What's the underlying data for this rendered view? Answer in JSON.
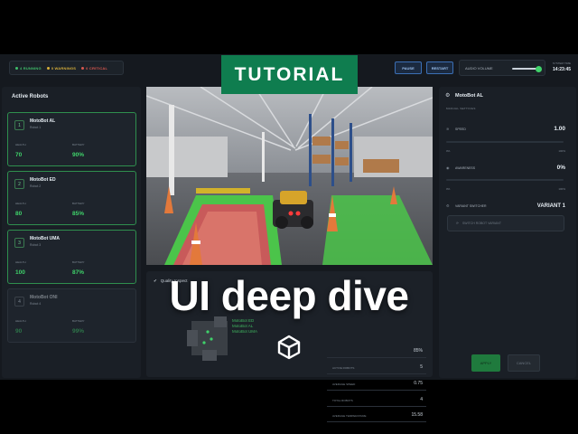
{
  "overlay": {
    "tutorial": "TUTORIAL",
    "headline": "UI deep dive"
  },
  "statusbar": {
    "running": "4 RUNNING",
    "warnings": "0 WARNINGS",
    "critical": "0 CRITICAL"
  },
  "toolbar": {
    "pause": "PAUSE",
    "restart": "RESTART",
    "audio_label": "AUDIO VOLUME",
    "system_time_label": "SYSTEM TIME",
    "system_time": "14:23:45"
  },
  "left_panel": {
    "title": "Active Robots",
    "health_label": "HEALTH",
    "battery_label": "BATTERY",
    "robots": [
      {
        "num": "1",
        "name": "MotoBot AL",
        "sub": "Robot 1",
        "health": "70",
        "battery": "90%"
      },
      {
        "num": "2",
        "name": "MotoBot ED",
        "sub": "Robot 2",
        "health": "80",
        "battery": "85%"
      },
      {
        "num": "3",
        "name": "MotoBot UMA",
        "sub": "Robot 3",
        "health": "100",
        "battery": "87%"
      },
      {
        "num": "4",
        "name": "MotoBot ONI",
        "sub": "Robot 4",
        "health": "90",
        "battery": "99%"
      }
    ]
  },
  "stats_panel": {
    "title": "Quality Inspect",
    "map_labels": [
      "MotoBot ED",
      "MotoBot AL",
      "MotoBot UMA"
    ],
    "rows": [
      {
        "key": "",
        "value": "85%"
      },
      {
        "key": "ACTIVE ROBOTS",
        "value": "5"
      },
      {
        "key": "AVERAGE SPEED",
        "value": "0.75"
      },
      {
        "key": "TOTAL ROBOTS",
        "value": "4"
      },
      {
        "key": "AVERAGE TEMPERATURE",
        "value": "15.58"
      }
    ]
  },
  "right_panel": {
    "title": "MotoBot AL",
    "section": "MANUAL SETTINGS",
    "speed_label": "SPEED",
    "speed_value": "1.00",
    "speed_min": "0%",
    "speed_max": "100%",
    "awareness_label": "AWARENESS",
    "awareness_value": "0%",
    "awareness_min": "0%",
    "awareness_max": "100%",
    "variant_label": "VARIANT SWITCHER",
    "variant_value": "VARIANT 1",
    "switch_label": "SWITCH ROBOT VARIANT",
    "apply_label": "APPLY",
    "cancel_label": "CANCEL"
  },
  "colors": {
    "accent": "#0f7d4f",
    "running": "#3fbf6a",
    "warning": "#d8b03a",
    "critical": "#d8574f",
    "value_green": "#3fd26a"
  }
}
